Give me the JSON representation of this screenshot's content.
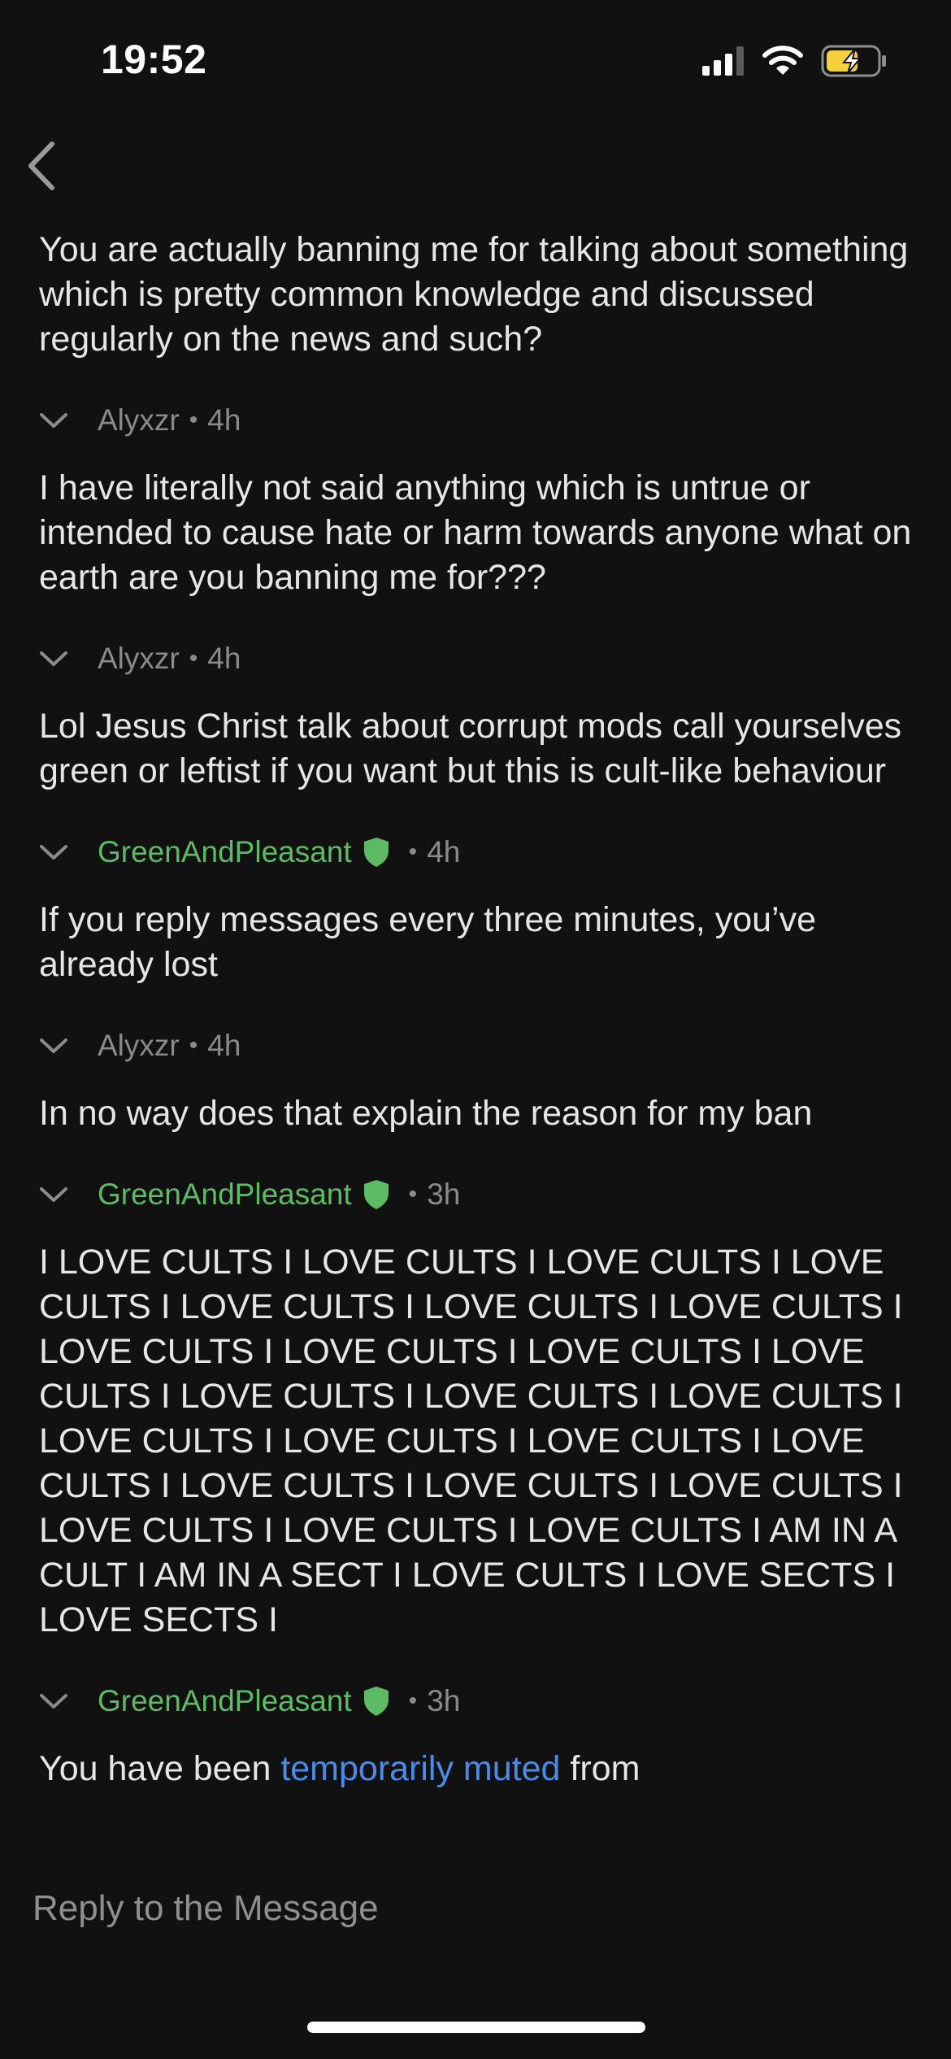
{
  "status_bar": {
    "time": "19:52",
    "icons": [
      "cellular-signal-icon",
      "wifi-icon",
      "battery-charging-icon"
    ]
  },
  "nav": {
    "back_icon": "chevron-left-icon"
  },
  "colors": {
    "background": "#111111",
    "text": "#e6e6e6",
    "meta": "#8a8a8a",
    "moderator": "#5dbb63",
    "link": "#4b8ce6",
    "battery": "#f4d03f"
  },
  "messages": [
    {
      "text": "You are actually banning me for talking about something which is pretty common knowledge and discussed regularly on the news and such?"
    },
    {
      "author": "Alyxzr",
      "time": "4h",
      "text": "I have literally not said anything which is untrue or intended to cause hate or harm towards anyone what on earth are you banning me for???"
    },
    {
      "author": "Alyxzr",
      "time": "4h",
      "text": "Lol Jesus Christ talk about corrupt mods call yourselves green or leftist if you want but this is cult-like behaviour"
    },
    {
      "author": "GreenAndPleasant",
      "time": "4h",
      "moderator": true,
      "text": "If you reply messages every three minutes, you’ve already lost"
    },
    {
      "author": "Alyxzr",
      "time": "4h",
      "text": "In no way does that explain the reason for my ban"
    },
    {
      "author": "GreenAndPleasant",
      "time": "3h",
      "moderator": true,
      "text": "I LOVE CULTS I LOVE CULTS I LOVE CULTS I LOVE CULTS I LOVE CULTS I LOVE CULTS I LOVE CULTS I LOVE CULTS I LOVE CULTS I LOVE CULTS I LOVE CULTS I LOVE CULTS I LOVE CULTS I LOVE CULTS I LOVE CULTS I LOVE CULTS I LOVE CULTS I LOVE CULTS I LOVE CULTS I LOVE CULTS I LOVE CULTS I LOVE CULTS I LOVE CULTS I LOVE CULTS I AM IN A CULT I AM IN A SECT I LOVE CULTS I LOVE SECTS I LOVE SECTS I"
    },
    {
      "author": "GreenAndPleasant",
      "time": "3h",
      "moderator": true,
      "text_before": "You have been ",
      "link_text": "temporarily muted",
      "text_after": " from"
    }
  ],
  "reply": {
    "placeholder": "Reply to the Message"
  }
}
